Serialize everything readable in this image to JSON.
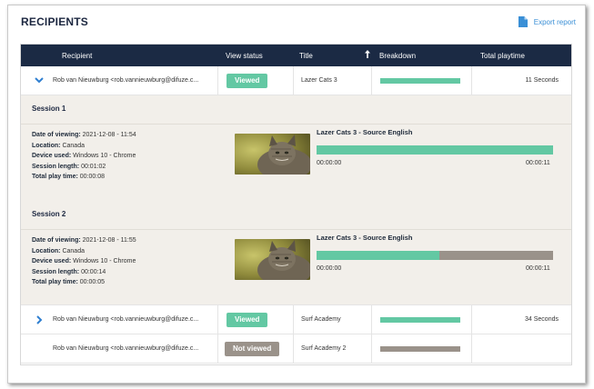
{
  "header": {
    "title": "RECIPIENTS",
    "export_label": "Export report"
  },
  "columns": {
    "recipient": "Recipient",
    "view_status": "View status",
    "title": "Title",
    "breakdown": "Breakdown",
    "total_playtime": "Total playtime"
  },
  "rows": [
    {
      "recipient": "Rob van Nieuwburg <rob.vannieuwburg@difuze.c...",
      "status": "Viewed",
      "title": "Lazer Cats 3",
      "playtime": "11 Seconds",
      "expanded": true
    },
    {
      "recipient": "Rob van Nieuwburg <rob.vannieuwburg@difuze.c...",
      "status": "Viewed",
      "title": "Surf Academy",
      "playtime": "34 Seconds",
      "expanded": false
    },
    {
      "recipient": "Rob van Nieuwburg <rob.vannieuwburg@difuze.c...",
      "status": "Not viewed",
      "title": "Surf Academy 2",
      "playtime": "",
      "expanded": false
    }
  ],
  "sessions": [
    {
      "heading": "Session 1",
      "date_label": "Date of viewing:",
      "date": "2021-12-08 - 11:54",
      "location_label": "Location:",
      "location": "Canada",
      "device_label": "Device used:",
      "device": "Windows 10 - Chrome",
      "length_label": "Session length:",
      "length": "00:01:02",
      "playtime_label": "Total play time:",
      "playtime": "00:00:08",
      "video_title": "Lazer Cats 3 - Source English",
      "start": "00:00:00",
      "end": "00:00:11",
      "progress": 1.0
    },
    {
      "heading": "Session 2",
      "date_label": "Date of viewing:",
      "date": "2021-12-08 - 11:55",
      "location_label": "Location:",
      "location": "Canada",
      "device_label": "Device used:",
      "device": "Windows 10 - Chrome",
      "length_label": "Session length:",
      "length": "00:00:14",
      "playtime_label": "Total play time:",
      "playtime": "00:00:05",
      "video_title": "Lazer Cats 3 - Source English",
      "start": "00:00:00",
      "end": "00:00:11",
      "progress": 0.52
    }
  ],
  "colors": {
    "header_bg": "#1b2a44",
    "viewed": "#63c8a3",
    "not_viewed": "#9a928a",
    "link": "#3a8fd6",
    "session_bg": "#f2efea"
  },
  "icons": {
    "export": "document-icon",
    "expanded": "chevron-down-icon",
    "collapsed": "chevron-right-icon",
    "sort": "arrow-up-icon"
  }
}
